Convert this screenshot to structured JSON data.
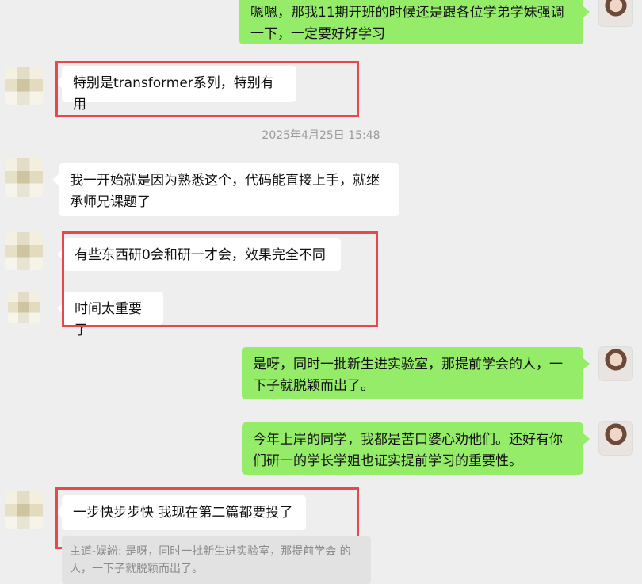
{
  "chat": {
    "timestamp": "2025年4月25日 15:48",
    "messages": [
      {
        "side": "right",
        "text": "嗯嗯，那我11期开班的时候还是跟各位学弟学妹强调\n一下，一定要好好学习"
      },
      {
        "side": "left",
        "text": "特别是transformer系列，特别有用"
      },
      {
        "side": "left",
        "text": "我一开始就是因为熟悉这个，代码能直接上手，就继\n承师兄课题了"
      },
      {
        "side": "left",
        "text": "有些东西研0会和研一才会，效果完全不同"
      },
      {
        "side": "left",
        "text": "时间太重要了"
      },
      {
        "side": "right",
        "text": "是呀，同时一批新生进实验室，那提前学会的人，一\n下子就脱颖而出了。"
      },
      {
        "side": "right",
        "text": "今年上岸的同学，我都是苦口婆心劝他们。还好有你\n们研一的学长学姐也证实提前学习的重要性。"
      },
      {
        "side": "left",
        "text": "一步快步步快 我现在第二篇都要投了"
      }
    ],
    "quote": {
      "text": "主道-娱紛: 是呀，同时一批新生进实验室，那提前学会\n的人，一下子就脱颖而出了。"
    }
  }
}
